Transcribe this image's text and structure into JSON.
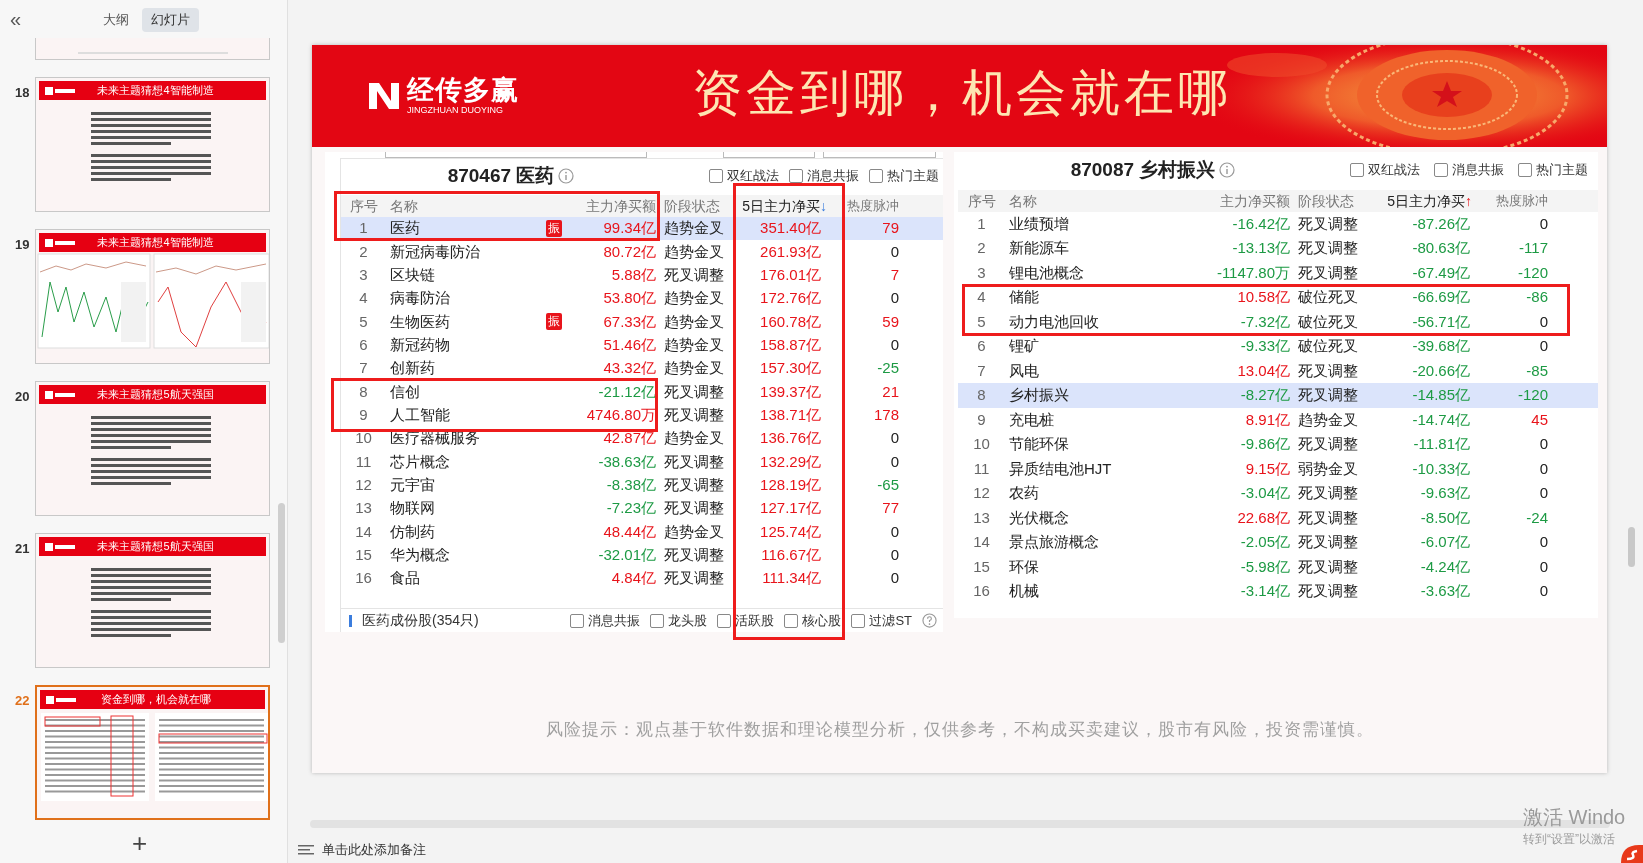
{
  "sidebar": {
    "collapse_glyph": "«",
    "tabs": [
      {
        "label": "大纲",
        "selected": false
      },
      {
        "label": "幻灯片",
        "selected": true
      }
    ],
    "slides": [
      {
        "number": "18",
        "title": "未来主题猜想4智能制造",
        "kind": "text",
        "selected": false
      },
      {
        "number": "19",
        "title": "未来主题猜想4智能制造",
        "kind": "chart",
        "selected": false
      },
      {
        "number": "20",
        "title": "未来主题猜想5航天强国",
        "kind": "text",
        "selected": false
      },
      {
        "number": "21",
        "title": "未来主题猜想5航天强国",
        "kind": "text",
        "selected": false
      },
      {
        "number": "22",
        "title": "资金到哪，机会就在哪",
        "kind": "tables",
        "selected": true
      }
    ],
    "add_glyph": "+"
  },
  "slide": {
    "logo": {
      "name": "经传多赢",
      "sub": "JINGZHUAN DUOYING"
    },
    "title": "资金到哪，机会就在哪",
    "panels": [
      {
        "title": "870467 医药",
        "filters": [
          {
            "label": "双红战法",
            "checked": false
          },
          {
            "label": "消息共振",
            "checked": false
          },
          {
            "label": "热门主题",
            "checked": false
          }
        ],
        "columns": [
          "序号",
          "名称",
          "主力净买额",
          "阶段状态",
          "5日主力净买",
          "热度脉冲"
        ],
        "sort_ascending": false,
        "sort_glyph": "↓",
        "rows": [
          {
            "index": "1",
            "name": "医药",
            "badge": "振",
            "net": {
              "text": "99.34亿",
              "color": "#e8141b"
            },
            "stage": "趋势金叉",
            "five": {
              "text": "351.40亿",
              "color": "#e8141b"
            },
            "heat": {
              "text": "79",
              "color": "#e8141b"
            },
            "selected": true
          },
          {
            "index": "2",
            "name": "新冠病毒防治",
            "net": {
              "text": "80.72亿",
              "color": "#e8141b"
            },
            "stage": "趋势金叉",
            "five": {
              "text": "261.93亿",
              "color": "#e8141b"
            },
            "heat": {
              "text": "0",
              "color": "#222222"
            },
            "selected": false
          },
          {
            "index": "3",
            "name": "区块链",
            "net": {
              "text": "5.88亿",
              "color": "#e8141b"
            },
            "stage": "死叉调整",
            "five": {
              "text": "176.01亿",
              "color": "#e8141b"
            },
            "heat": {
              "text": "7",
              "color": "#e8141b"
            },
            "selected": false
          },
          {
            "index": "4",
            "name": "病毒防治",
            "net": {
              "text": "53.80亿",
              "color": "#e8141b"
            },
            "stage": "趋势金叉",
            "five": {
              "text": "172.76亿",
              "color": "#e8141b"
            },
            "heat": {
              "text": "0",
              "color": "#222222"
            },
            "selected": false
          },
          {
            "index": "5",
            "name": "生物医药",
            "badge": "振",
            "net": {
              "text": "67.33亿",
              "color": "#e8141b"
            },
            "stage": "趋势金叉",
            "five": {
              "text": "160.78亿",
              "color": "#e8141b"
            },
            "heat": {
              "text": "59",
              "color": "#e8141b"
            },
            "selected": false
          },
          {
            "index": "6",
            "name": "新冠药物",
            "net": {
              "text": "51.46亿",
              "color": "#e8141b"
            },
            "stage": "趋势金叉",
            "five": {
              "text": "158.87亿",
              "color": "#e8141b"
            },
            "heat": {
              "text": "0",
              "color": "#222222"
            },
            "selected": false
          },
          {
            "index": "7",
            "name": "创新药",
            "net": {
              "text": "43.32亿",
              "color": "#e8141b"
            },
            "stage": "趋势金叉",
            "five": {
              "text": "157.30亿",
              "color": "#e8141b"
            },
            "heat": {
              "text": "-25",
              "color": "#1d9a44"
            },
            "selected": false
          },
          {
            "index": "8",
            "name": "信创",
            "net": {
              "text": "-21.12亿",
              "color": "#1d9a44"
            },
            "stage": "死叉调整",
            "five": {
              "text": "139.37亿",
              "color": "#e8141b"
            },
            "heat": {
              "text": "21",
              "color": "#e8141b"
            },
            "selected": false
          },
          {
            "index": "9",
            "name": "人工智能",
            "net": {
              "text": "4746.80万",
              "color": "#e8141b"
            },
            "stage": "死叉调整",
            "five": {
              "text": "138.71亿",
              "color": "#e8141b"
            },
            "heat": {
              "text": "178",
              "color": "#e8141b"
            },
            "selected": false
          },
          {
            "index": "10",
            "name": "医疗器械服务",
            "net": {
              "text": "42.87亿",
              "color": "#e8141b"
            },
            "stage": "趋势金叉",
            "five": {
              "text": "136.76亿",
              "color": "#e8141b"
            },
            "heat": {
              "text": "0",
              "color": "#222222"
            },
            "selected": false
          },
          {
            "index": "11",
            "name": "芯片概念",
            "net": {
              "text": "-38.63亿",
              "color": "#1d9a44"
            },
            "stage": "死叉调整",
            "five": {
              "text": "132.29亿",
              "color": "#e8141b"
            },
            "heat": {
              "text": "0",
              "color": "#222222"
            },
            "selected": false
          },
          {
            "index": "12",
            "name": "元宇宙",
            "net": {
              "text": "-8.38亿",
              "color": "#1d9a44"
            },
            "stage": "死叉调整",
            "five": {
              "text": "128.19亿",
              "color": "#e8141b"
            },
            "heat": {
              "text": "-65",
              "color": "#1d9a44"
            },
            "selected": false
          },
          {
            "index": "13",
            "name": "物联网",
            "net": {
              "text": "-7.23亿",
              "color": "#1d9a44"
            },
            "stage": "死叉调整",
            "five": {
              "text": "127.17亿",
              "color": "#e8141b"
            },
            "heat": {
              "text": "77",
              "color": "#e8141b"
            },
            "selected": false
          },
          {
            "index": "14",
            "name": "仿制药",
            "net": {
              "text": "48.44亿",
              "color": "#e8141b"
            },
            "stage": "趋势金叉",
            "five": {
              "text": "125.74亿",
              "color": "#e8141b"
            },
            "heat": {
              "text": "0",
              "color": "#222222"
            },
            "selected": false
          },
          {
            "index": "15",
            "name": "华为概念",
            "net": {
              "text": "-32.01亿",
              "color": "#1d9a44"
            },
            "stage": "死叉调整",
            "five": {
              "text": "116.67亿",
              "color": "#e8141b"
            },
            "heat": {
              "text": "0",
              "color": "#222222"
            },
            "selected": false
          },
          {
            "index": "16",
            "name": "食品",
            "net": {
              "text": "4.84亿",
              "color": "#e8141b"
            },
            "stage": "死叉调整",
            "five": {
              "text": "111.34亿",
              "color": "#e8141b"
            },
            "heat": {
              "text": "0",
              "color": "#222222"
            },
            "selected": false
          }
        ],
        "footer": {
          "label": "医药成份股(354只)",
          "filters": [
            {
              "label": "消息共振",
              "checked": false
            },
            {
              "label": "龙头股",
              "checked": false
            },
            {
              "label": "活跃股",
              "checked": false
            },
            {
              "label": "核心股",
              "checked": false
            },
            {
              "label": "过滤ST",
              "checked": false
            }
          ]
        }
      },
      {
        "title": "870087 乡村振兴",
        "filters": [
          {
            "label": "双红战法",
            "checked": false
          },
          {
            "label": "消息共振",
            "checked": false
          },
          {
            "label": "热门主题",
            "checked": false
          }
        ],
        "columns": [
          "序号",
          "名称",
          "主力净买额",
          "阶段状态",
          "5日主力净买",
          "热度脉冲"
        ],
        "sort_ascending": true,
        "sort_glyph": "↑",
        "rows": [
          {
            "index": "1",
            "name": "业绩预增",
            "net": {
              "text": "-16.42亿",
              "color": "#1d9a44"
            },
            "stage": "死叉调整",
            "five": {
              "text": "-87.26亿",
              "color": "#1d9a44"
            },
            "heat": {
              "text": "0",
              "color": "#222222"
            },
            "selected": false
          },
          {
            "index": "2",
            "name": "新能源车",
            "net": {
              "text": "-13.13亿",
              "color": "#1d9a44"
            },
            "stage": "死叉调整",
            "five": {
              "text": "-80.63亿",
              "color": "#1d9a44"
            },
            "heat": {
              "text": "-117",
              "color": "#1d9a44"
            },
            "selected": false
          },
          {
            "index": "3",
            "name": "锂电池概念",
            "net": {
              "text": "-1147.80万",
              "color": "#1d9a44"
            },
            "stage": "死叉调整",
            "five": {
              "text": "-67.49亿",
              "color": "#1d9a44"
            },
            "heat": {
              "text": "-120",
              "color": "#1d9a44"
            },
            "selected": false
          },
          {
            "index": "4",
            "name": "储能",
            "net": {
              "text": "10.58亿",
              "color": "#e8141b"
            },
            "stage": "破位死叉",
            "five": {
              "text": "-66.69亿",
              "color": "#1d9a44"
            },
            "heat": {
              "text": "-86",
              "color": "#1d9a44"
            },
            "selected": false
          },
          {
            "index": "5",
            "name": "动力电池回收",
            "net": {
              "text": "-7.32亿",
              "color": "#1d9a44"
            },
            "stage": "破位死叉",
            "five": {
              "text": "-56.71亿",
              "color": "#1d9a44"
            },
            "heat": {
              "text": "0",
              "color": "#222222"
            },
            "selected": false
          },
          {
            "index": "6",
            "name": "锂矿",
            "net": {
              "text": "-9.33亿",
              "color": "#1d9a44"
            },
            "stage": "破位死叉",
            "five": {
              "text": "-39.68亿",
              "color": "#1d9a44"
            },
            "heat": {
              "text": "0",
              "color": "#222222"
            },
            "selected": false
          },
          {
            "index": "7",
            "name": "风电",
            "net": {
              "text": "13.04亿",
              "color": "#e8141b"
            },
            "stage": "死叉调整",
            "five": {
              "text": "-20.66亿",
              "color": "#1d9a44"
            },
            "heat": {
              "text": "-85",
              "color": "#1d9a44"
            },
            "selected": false
          },
          {
            "index": "8",
            "name": "乡村振兴",
            "net": {
              "text": "-8.27亿",
              "color": "#1d9a44"
            },
            "stage": "死叉调整",
            "five": {
              "text": "-14.85亿",
              "color": "#1d9a44"
            },
            "heat": {
              "text": "-120",
              "color": "#1d9a44"
            },
            "selected": true
          },
          {
            "index": "9",
            "name": "充电桩",
            "net": {
              "text": "8.91亿",
              "color": "#e8141b"
            },
            "stage": "趋势金叉",
            "five": {
              "text": "-14.74亿",
              "color": "#1d9a44"
            },
            "heat": {
              "text": "45",
              "color": "#e8141b"
            },
            "selected": false
          },
          {
            "index": "10",
            "name": "节能环保",
            "net": {
              "text": "-9.86亿",
              "color": "#1d9a44"
            },
            "stage": "死叉调整",
            "five": {
              "text": "-11.81亿",
              "color": "#1d9a44"
            },
            "heat": {
              "text": "0",
              "color": "#222222"
            },
            "selected": false
          },
          {
            "index": "11",
            "name": "异质结电池HJT",
            "net": {
              "text": "9.15亿",
              "color": "#e8141b"
            },
            "stage": "弱势金叉",
            "five": {
              "text": "-10.33亿",
              "color": "#1d9a44"
            },
            "heat": {
              "text": "0",
              "color": "#222222"
            },
            "selected": false
          },
          {
            "index": "12",
            "name": "农药",
            "net": {
              "text": "-3.04亿",
              "color": "#1d9a44"
            },
            "stage": "死叉调整",
            "five": {
              "text": "-9.63亿",
              "color": "#1d9a44"
            },
            "heat": {
              "text": "0",
              "color": "#222222"
            },
            "selected": false
          },
          {
            "index": "13",
            "name": "光伏概念",
            "net": {
              "text": "22.68亿",
              "color": "#e8141b"
            },
            "stage": "死叉调整",
            "five": {
              "text": "-8.50亿",
              "color": "#1d9a44"
            },
            "heat": {
              "text": "-24",
              "color": "#1d9a44"
            },
            "selected": false
          },
          {
            "index": "14",
            "name": "景点旅游概念",
            "net": {
              "text": "-2.05亿",
              "color": "#1d9a44"
            },
            "stage": "死叉调整",
            "five": {
              "text": "-6.07亿",
              "color": "#1d9a44"
            },
            "heat": {
              "text": "0",
              "color": "#222222"
            },
            "selected": false
          },
          {
            "index": "15",
            "name": "环保",
            "net": {
              "text": "-5.98亿",
              "color": "#1d9a44"
            },
            "stage": "死叉调整",
            "five": {
              "text": "-4.24亿",
              "color": "#1d9a44"
            },
            "heat": {
              "text": "0",
              "color": "#222222"
            },
            "selected": false
          },
          {
            "index": "16",
            "name": "机械",
            "net": {
              "text": "-3.14亿",
              "color": "#1d9a44"
            },
            "stage": "死叉调整",
            "five": {
              "text": "-3.63亿",
              "color": "#1d9a44"
            },
            "heat": {
              "text": "0",
              "color": "#222222"
            },
            "selected": false
          }
        ]
      }
    ],
    "disclaimer": "风险提示：观点基于软件数据和理论模型分析，仅供参考，不构成买卖建议，股市有风险，投资需谨慎。"
  },
  "notes": {
    "placeholder": "单击此处添加备注"
  },
  "activation": {
    "title": "激活 Windo",
    "hint": "转到“设置”以激活"
  }
}
